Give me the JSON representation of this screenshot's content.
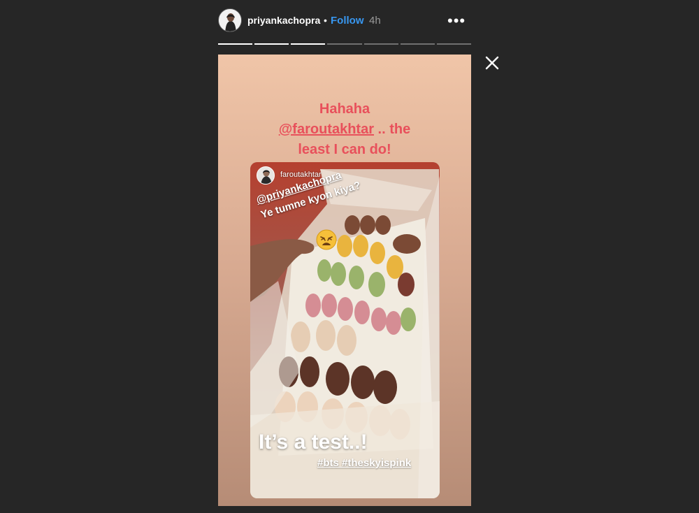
{
  "header": {
    "username": "priyankachopra",
    "dot": "•",
    "follow_label": "Follow",
    "time": "4h",
    "more_label": "•••"
  },
  "progress": {
    "total_segments": 7,
    "completed_segments": 3
  },
  "story": {
    "caption_line1": "Hahaha",
    "caption_mention": "@faroutakhtar",
    "caption_line2_rest": " .. the",
    "caption_line3": "least I can do!",
    "inner": {
      "username": "faroutakhtar",
      "mention": "@priyankachopra",
      "text": "Ye tumne kyon kiya?",
      "emoji": "weary-face-emoji",
      "overlay_title": "It’s a test..!",
      "hashtags": "#bts #theskyispink"
    }
  },
  "colors": {
    "background": "#262626",
    "follow": "#3897f0",
    "caption": "#e8505b"
  },
  "icons": [
    "close-icon",
    "more-icon"
  ]
}
